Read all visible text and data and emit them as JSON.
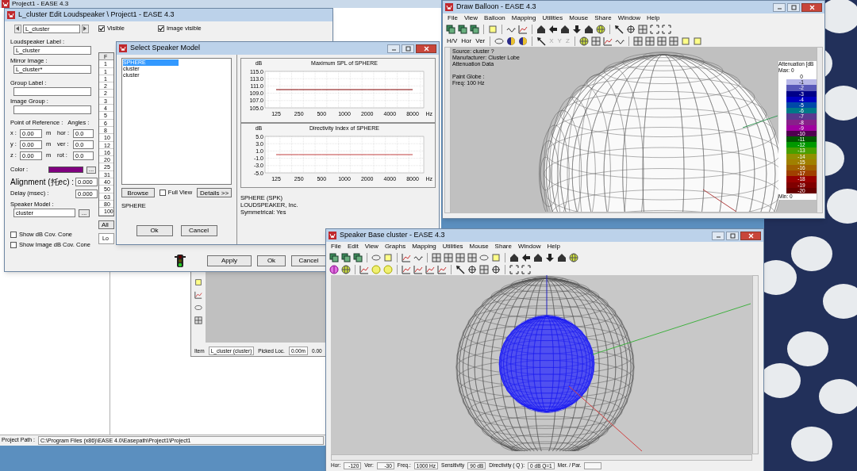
{
  "project_window": {
    "title": "Project1 - EASE 4.3",
    "path_label": "Project Path :",
    "path": "C:\\Program Files (x86)\\EASE 4.0\\Easepath\\Project1\\Project1"
  },
  "back_window": {
    "status": [
      "Item",
      "L_cluster (cluster)",
      "Picked Loc.",
      "0.00m",
      "0.00"
    ]
  },
  "edit_dialog": {
    "title": "L_cluster Edit Loudspeaker \\ Project1 - EASE 4.3",
    "selector": "L_cluster",
    "checkboxes": [
      {
        "label": "Visible",
        "checked": true
      },
      {
        "label": "Image visible",
        "checked": true
      }
    ],
    "fields": [
      {
        "label": "Loudspeaker Label :",
        "value": "L_cluster"
      },
      {
        "label": "Mirror Image :",
        "value": "L_cluster*"
      },
      {
        "label": "Group Label :"
      },
      {
        "label": "Image Group :"
      }
    ],
    "reference_label": "Point of Reference :",
    "angles_label": "Angles :",
    "coordinates": [
      {
        "axis": "x :",
        "value": "0.00",
        "unit": "m",
        "angle_label": "hor :",
        "angle": "0.0"
      },
      {
        "axis": "y :",
        "value": "0.00",
        "unit": "m",
        "angle_label": "ver :",
        "angle": "0.0"
      },
      {
        "axis": "z :",
        "value": "0.00",
        "unit": "m",
        "angle_label": "rot :",
        "angle": "0.0"
      }
    ],
    "color_label": "Color :",
    "color": "#800080",
    "color_button": "...",
    "alignment": {
      "label": "Alignment (托ec) :",
      "value": "0.000"
    },
    "delay": {
      "label": "Delay (msec) :",
      "value": "0.000"
    },
    "speaker_model": {
      "label": "Speaker Model :",
      "value": "cluster",
      "button": "..."
    },
    "options": [
      {
        "label": "Show dB Cov. Cone",
        "checked": false
      },
      {
        "label": "Show Image dB Cov. Cone",
        "checked": false
      }
    ],
    "freq_column": {
      "header": "F",
      "rows": [
        "1",
        "1",
        "1",
        "2",
        "2",
        "3",
        "4",
        "5",
        "6",
        "8",
        "10",
        "12",
        "16",
        "20",
        "25",
        "31",
        "40",
        "50",
        "63",
        "80",
        "100"
      ]
    },
    "all_button": "All",
    "lo_tab": "Lo",
    "buttons": [
      "Apply",
      "Ok",
      "Cancel"
    ]
  },
  "select_dialog": {
    "title": "Select Speaker Model",
    "models": [
      {
        "label": "SPHERE",
        "selected": true
      },
      {
        "label": "cluster",
        "selected": false
      },
      {
        "label": "cluster",
        "selected": false
      }
    ],
    "browse": "Browse",
    "full_view": {
      "label": "Full View",
      "checked": false
    },
    "details": "Details >>",
    "current": "SPHERE",
    "buttons": [
      "Ok",
      "Cancel"
    ],
    "charts": [
      {
        "chart_data": {
          "type": "line",
          "title": "Maximum SPL of SPHERE",
          "xlabel": "Hz",
          "ylabel": "dB",
          "categories": [
            "125",
            "250",
            "500",
            "1000",
            "2000",
            "4000",
            "8000"
          ],
          "grid": true,
          "series": [
            {
              "color": "#800000",
              "values": [
                110,
                110,
                110,
                110,
                110,
                110,
                110
              ]
            }
          ],
          "ylim": [
            105,
            115
          ],
          "yticks": [
            {
              "value": 105,
              "label": "105.0"
            },
            {
              "value": 107,
              "label": "107.0"
            },
            {
              "value": 109,
              "label": "109.0"
            },
            {
              "value": 111,
              "label": "111.0"
            },
            {
              "value": 113,
              "label": "113.0"
            },
            {
              "value": 115,
              "label": "115.0"
            }
          ]
        }
      },
      {
        "chart_data": {
          "type": "line",
          "title": "Directivity Index of SPHERE",
          "xlabel": "Hz",
          "ylabel": "dB",
          "categories": [
            "125",
            "250",
            "500",
            "1000",
            "2000",
            "4000",
            "8000"
          ],
          "grid": true,
          "series": [
            {
              "color": "#c04040",
              "values": [
                0,
                0,
                0,
                0,
                0,
                0,
                0
              ]
            }
          ],
          "ylim": [
            -5,
            5
          ],
          "yticks": [
            {
              "value": -5,
              "label": "-5.0"
            },
            {
              "value": -3,
              "label": "-3.0"
            },
            {
              "value": -1,
              "label": "-1.0"
            },
            {
              "value": 1,
              "label": "1.0"
            },
            {
              "value": 3,
              "label": "3.0"
            },
            {
              "value": 5,
              "label": "5.0"
            }
          ]
        }
      }
    ],
    "info": [
      "SPHERE (SPK)",
      "LOUDSPEAKER, Inc.",
      "Symmetrical: Yes"
    ]
  },
  "balloon_window": {
    "title": "Draw Balloon  - EASE 4.3",
    "menu": [
      "File",
      "View",
      "Balloon",
      "Mapping",
      "Utilities",
      "Mouse",
      "Share",
      "Window",
      "Help"
    ],
    "toolbar_labels": [
      {
        "label": "H/V",
        "disabled": false
      },
      {
        "label": "Hor",
        "disabled": false
      },
      {
        "label": "Ver",
        "disabled": false
      },
      {
        "label": "X",
        "disabled": true
      },
      {
        "label": "Y",
        "disabled": true
      },
      {
        "label": "Z",
        "disabled": true
      }
    ],
    "info": [
      "Source: cluster ?",
      "Manufacturer: Cluster Lobe",
      "Attenuation Data"
    ],
    "paint": [
      "Paint Globe :",
      "Freq: 100 Hz"
    ],
    "legend": {
      "title": "Attenuation [dB",
      "max": "Max:  0",
      "min": "Min:  0",
      "steps": [
        {
          "label": "0",
          "color": "#ffffff"
        },
        {
          "label": "-1",
          "color": "#b8b8e8"
        },
        {
          "label": "-2",
          "color": "#5858b8"
        },
        {
          "label": "-3",
          "color": "#000088"
        },
        {
          "label": "-4",
          "color": "#0000c0"
        },
        {
          "label": "-5",
          "color": "#0048a8"
        },
        {
          "label": "-6",
          "color": "#007888"
        },
        {
          "label": "-7",
          "color": "#5a3890"
        },
        {
          "label": "-8",
          "color": "#88208a"
        },
        {
          "label": "-9",
          "color": "#a000a0"
        },
        {
          "label": "-10",
          "color": "#500050"
        },
        {
          "label": "-11",
          "color": "#005800"
        },
        {
          "label": "-12",
          "color": "#009800"
        },
        {
          "label": "-13",
          "color": "#48a000"
        },
        {
          "label": "-14",
          "color": "#909000"
        },
        {
          "label": "-15",
          "color": "#a08000"
        },
        {
          "label": "-16",
          "color": "#a06000"
        },
        {
          "label": "-17",
          "color": "#a04000"
        },
        {
          "label": "-18",
          "color": "#980000"
        },
        {
          "label": "-19",
          "color": "#800000"
        },
        {
          "label": "-20",
          "color": "#680000"
        }
      ]
    }
  },
  "base_window": {
    "title": "Speaker Base cluster - EASE 4.3",
    "menu": [
      "File",
      "Edit",
      "View",
      "Graphs",
      "Mapping",
      "Utilities",
      "Mouse",
      "Share",
      "Window",
      "Help"
    ],
    "status": [
      {
        "label": "Hor:",
        "value": "-120"
      },
      {
        "label": "Ver:",
        "value": "-30"
      },
      {
        "label": "Freq.:",
        "value": "1000 Hz"
      },
      {
        "label": "Sensitivity",
        "value": "90 dB"
      },
      {
        "label": "Directivity ( Q ):",
        "value": "0 dB Q=1"
      },
      {
        "label": "Mer. / Par."
      }
    ]
  }
}
